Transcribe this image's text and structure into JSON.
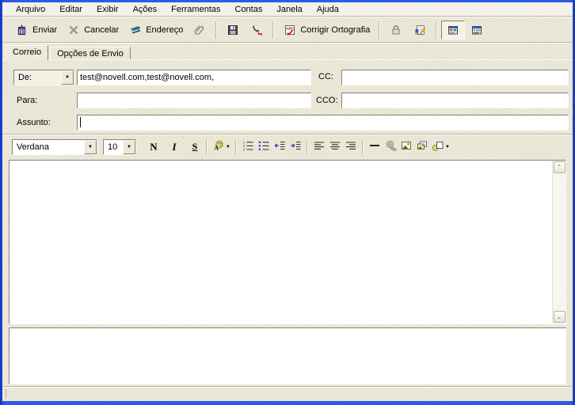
{
  "window": {
    "app": "GroupWise compose mail window (pt-BR)",
    "colors": {
      "frame_blue": "#2d5be6",
      "chrome_beige": "#ece9d8",
      "field_white": "#ffffff"
    }
  },
  "menu": {
    "items": [
      "Arquivo",
      "Editar",
      "Exibir",
      "Ações",
      "Ferramentas",
      "Contas",
      "Janela",
      "Ajuda"
    ]
  },
  "toolbar": {
    "send_label": "Enviar",
    "cancel_label": "Cancelar",
    "address_label": "Endereço",
    "spellcheck_label": "Corrigir Ortografia",
    "icons": [
      "send-icon",
      "cancel-x-icon",
      "address-book-icon",
      "paperclip-icon",
      "save-icon",
      "route-icon",
      "spellcheck-abc-icon",
      "lock-icon",
      "signature-icon",
      "html-view-icon",
      "plain-view-icon"
    ],
    "html_view_pressed": true
  },
  "tabs": [
    {
      "label": "Correio",
      "active": true
    },
    {
      "label": "Opções de Envio",
      "active": false
    }
  ],
  "form": {
    "from_label": "De:",
    "from_value": "test@novell.com,test@novell.com,",
    "cc_label": "CC:",
    "cc_value": "",
    "to_label": "Para:",
    "to_value": "",
    "bcc_label": "CCO:",
    "bcc_value": "",
    "subject_label": "Assunto:",
    "subject_value": ""
  },
  "format_toolbar": {
    "font_family_value": "Verdana",
    "font_size_value": "10",
    "bold_label": "N",
    "italic_label": "I",
    "underline_label": "S",
    "icons": [
      "font-color-icon",
      "numbered-list-icon",
      "bullet-list-icon",
      "outdent-icon",
      "indent-icon",
      "align-left-icon",
      "align-center-icon",
      "align-right-icon",
      "horizontal-rule-icon",
      "hyperlink-icon-disabled",
      "insert-image-icon",
      "insert-picture-icon",
      "insert-object-icon"
    ]
  },
  "body": {
    "text": ""
  },
  "attachments": {
    "items": []
  },
  "statusbar": {
    "text": ""
  }
}
